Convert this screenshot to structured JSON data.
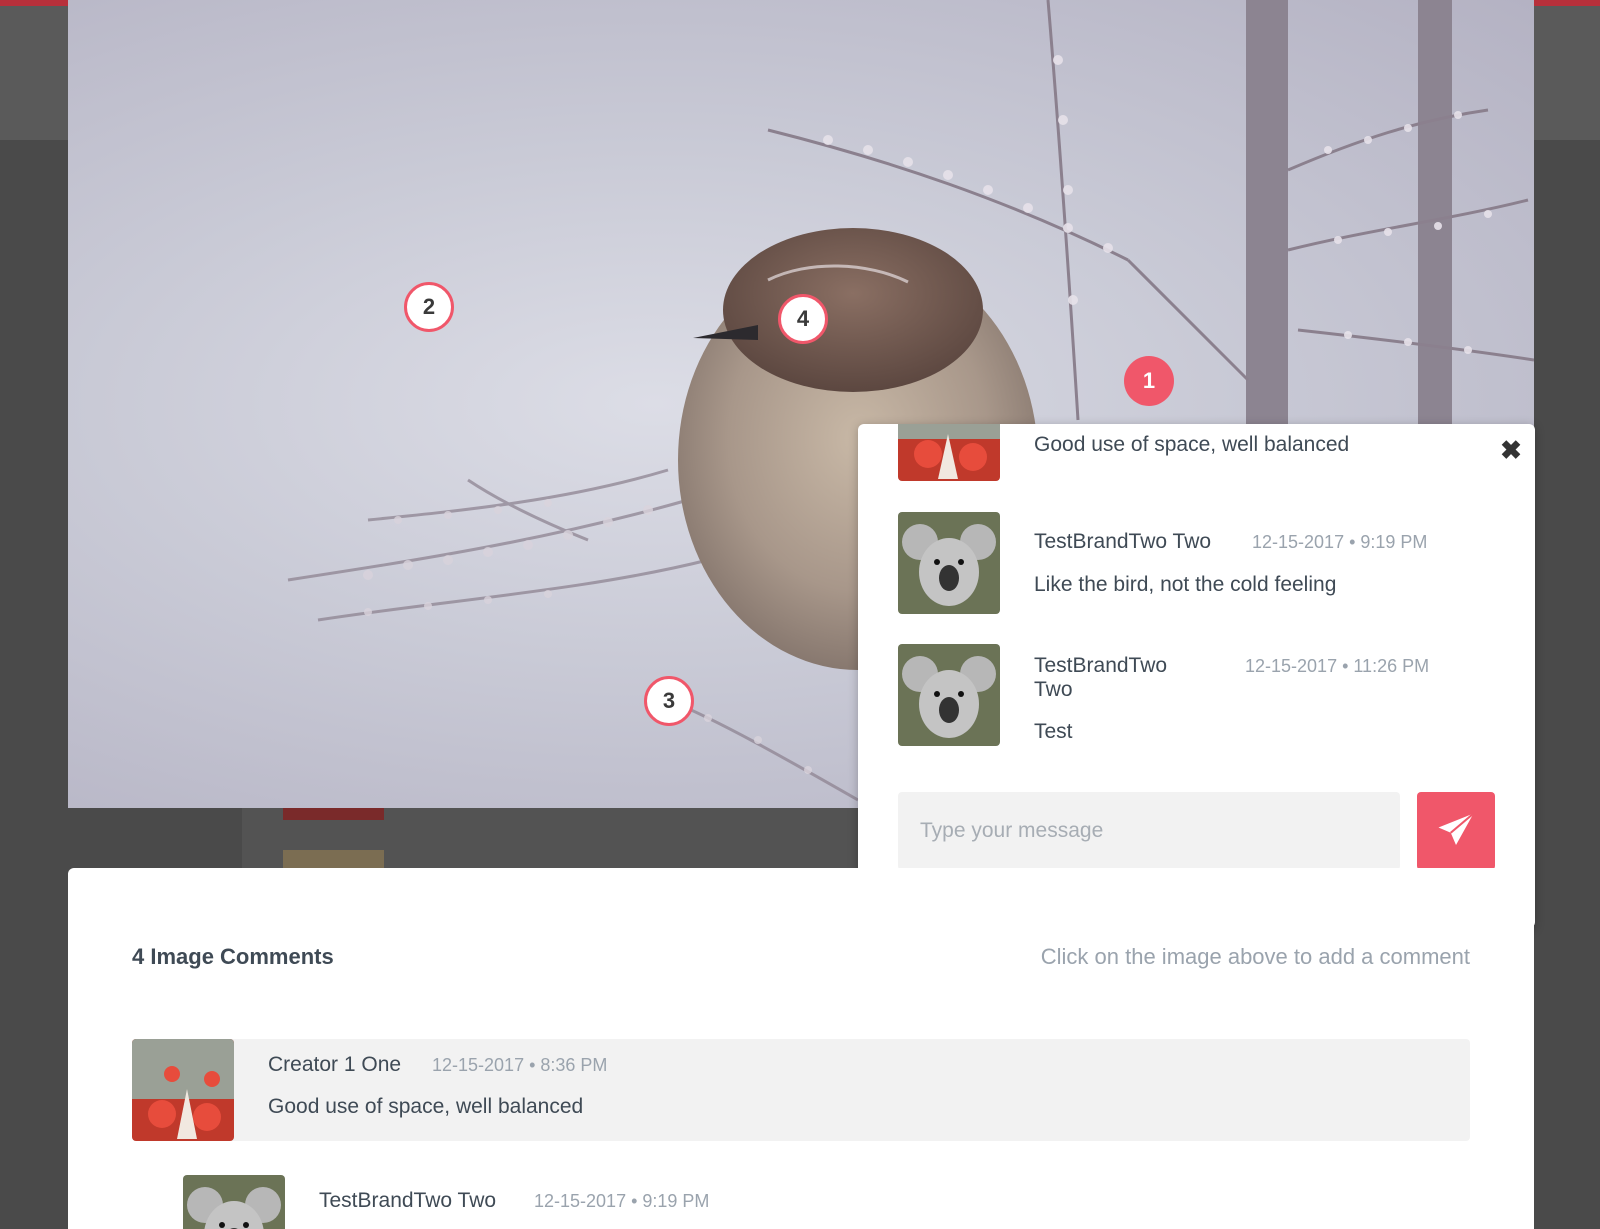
{
  "photo_markers": [
    "1",
    "2",
    "3",
    "4"
  ],
  "popover": {
    "comments": [
      {
        "author": "",
        "timestamp": "",
        "text": "Good use of space, well balanced",
        "avatar": "gnome-avatar"
      },
      {
        "author": "TestBrandTwo Two",
        "timestamp": "12-15-2017 • 9:19 PM",
        "text": "Like the bird, not the cold feeling",
        "avatar": "koala-avatar"
      },
      {
        "author": "TestBrandTwo Two",
        "timestamp": "12-15-2017 • 11:26 PM",
        "text": "Test",
        "avatar": "koala-avatar"
      }
    ],
    "input_placeholder": "Type your message",
    "close_icon": "close-icon",
    "send_icon": "paper-plane-icon"
  },
  "comments_section": {
    "count_label": "4 Image Comments",
    "hint": "Click on the image above to add a comment",
    "comments": [
      {
        "author": "Creator 1 One",
        "timestamp": "12-15-2017 • 8:36 PM",
        "text": "Good use of space, well balanced",
        "avatar": "gnome-avatar"
      },
      {
        "author": "TestBrandTwo Two",
        "timestamp": "12-15-2017 • 9:19 PM",
        "text": "",
        "avatar": "koala-avatar"
      }
    ]
  },
  "colors": {
    "accent": "#f0576a",
    "text": "#3f4a55",
    "muted": "#9aa3ad",
    "highlight_row": "#f2f2f2"
  }
}
